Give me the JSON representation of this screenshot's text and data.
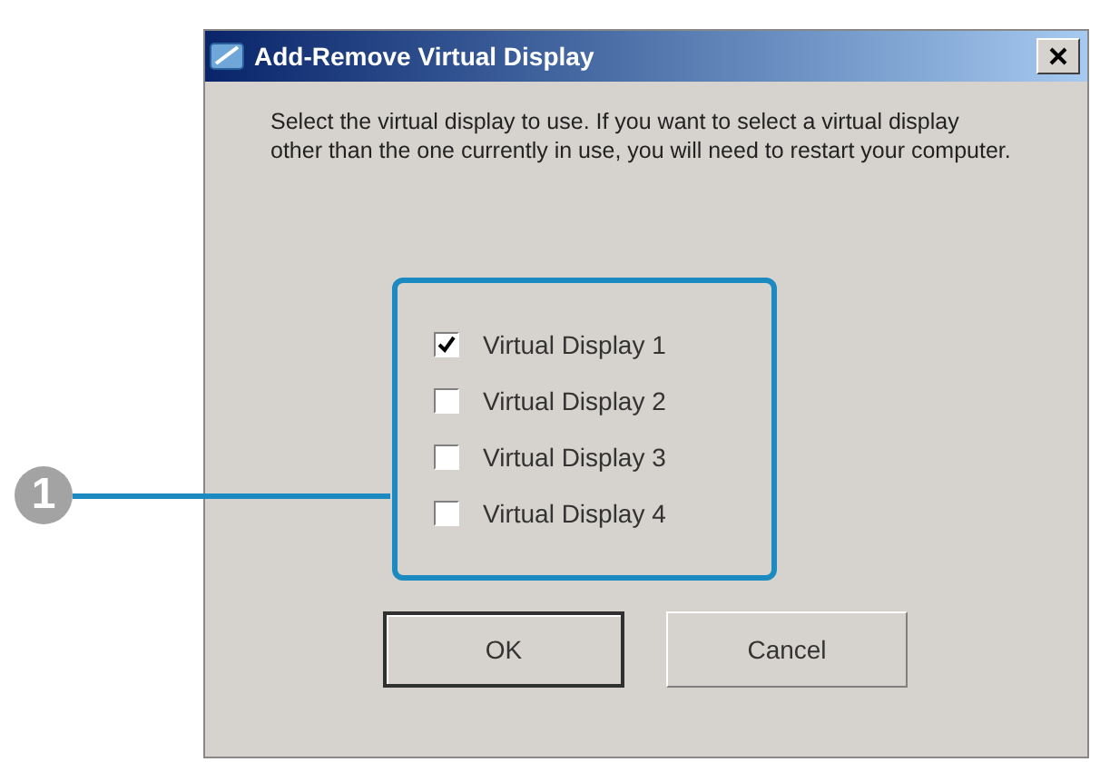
{
  "window": {
    "title": "Add-Remove Virtual Display"
  },
  "message": "Select the virtual display to use. If you want to select a virtual display other than the one currently in use, you will need to restart your computer.",
  "options": [
    {
      "label": "Virtual Display 1",
      "checked": true
    },
    {
      "label": "Virtual Display 2",
      "checked": false
    },
    {
      "label": "Virtual Display 3",
      "checked": false
    },
    {
      "label": "Virtual Display 4",
      "checked": false
    }
  ],
  "buttons": [
    {
      "label": "OK",
      "default": true
    },
    {
      "label": "Cancel",
      "default": false
    }
  ],
  "callout": {
    "number": "1"
  }
}
